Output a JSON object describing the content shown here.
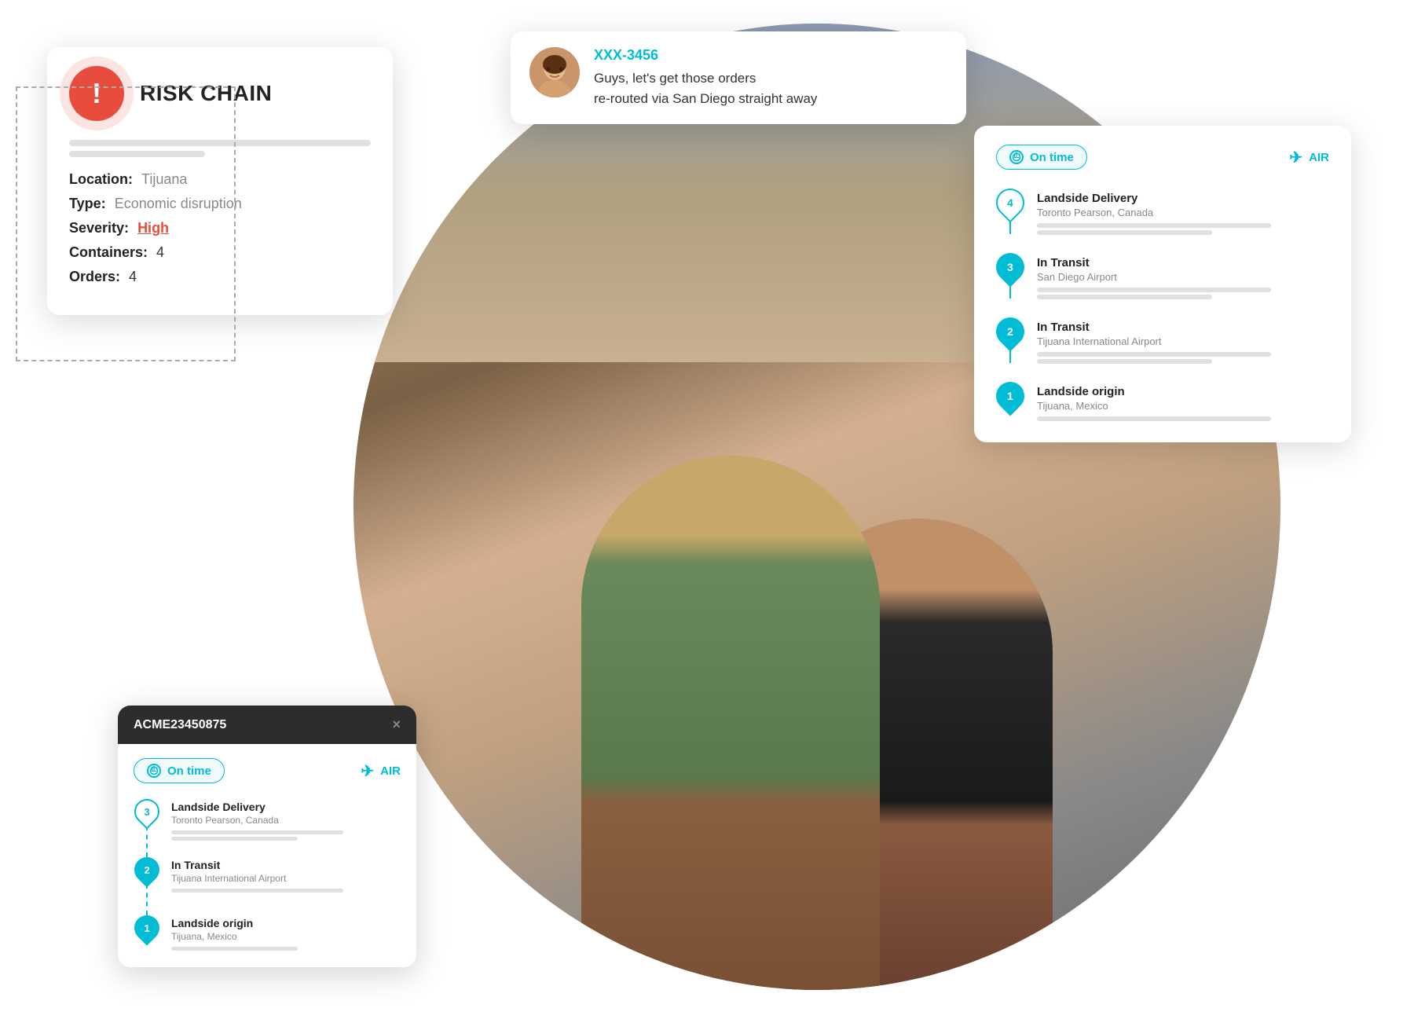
{
  "scene": {
    "background": {
      "description": "Warehouse photo background with two people looking at laptop"
    }
  },
  "risk_chain_card": {
    "title": "RISK CHAIN",
    "icon": "!",
    "gray_lines": [
      "full",
      "half"
    ],
    "fields": [
      {
        "label": "Location:",
        "value": "Tijuana",
        "style": "gray"
      },
      {
        "label": "Type:",
        "value": "Economic disruption",
        "style": "gray"
      },
      {
        "label": "Severity:",
        "value": "High",
        "style": "red"
      },
      {
        "label": "Containers:",
        "value": "4",
        "style": "dark"
      },
      {
        "label": "Orders:",
        "value": "4",
        "style": "dark"
      }
    ]
  },
  "chat_bubble": {
    "user_id": "XXX-3456",
    "message_line1": "Guys, let's get those orders",
    "message_line2": "re-routed via San Diego straight away"
  },
  "route_card_right": {
    "on_time_label": "On time",
    "air_label": "AIR",
    "stops": [
      {
        "number": "4",
        "style": "outline",
        "title": "Landside Delivery",
        "subtitle": "Toronto Pearson, Canada",
        "bars": [
          "w80",
          "w60"
        ],
        "has_line": false
      },
      {
        "number": "3",
        "style": "filled",
        "title": "In Transit",
        "subtitle": "San Diego Airport",
        "bars": [
          "w70",
          "w55"
        ],
        "has_line": true
      },
      {
        "number": "2",
        "style": "filled",
        "title": "In Transit",
        "subtitle": "Tijuana International Airport",
        "bars": [
          "w80",
          "w60"
        ],
        "has_line": true
      },
      {
        "number": "1",
        "style": "filled",
        "title": "Landside origin",
        "subtitle": "Tijuana, Mexico",
        "bars": [
          "w70"
        ],
        "has_line": true
      }
    ]
  },
  "shipment_card": {
    "id": "ACME23450875",
    "on_time_label": "On time",
    "air_label": "AIR",
    "close_symbol": "×",
    "stops": [
      {
        "number": "3",
        "style": "outline",
        "title": "Landside Delivery",
        "subtitle": "Toronto Pearson, Canada",
        "bars": [
          "w75",
          "w55"
        ],
        "has_line": false
      },
      {
        "number": "2",
        "style": "filled",
        "title": "In Transit",
        "subtitle": "Tijuana International Airport",
        "bars": [
          "w75"
        ],
        "has_line": true
      },
      {
        "number": "1",
        "style": "filled",
        "title": "Landside origin",
        "subtitle": "Tijuana, Mexico",
        "bars": [
          "w55"
        ],
        "has_line": true
      }
    ]
  }
}
